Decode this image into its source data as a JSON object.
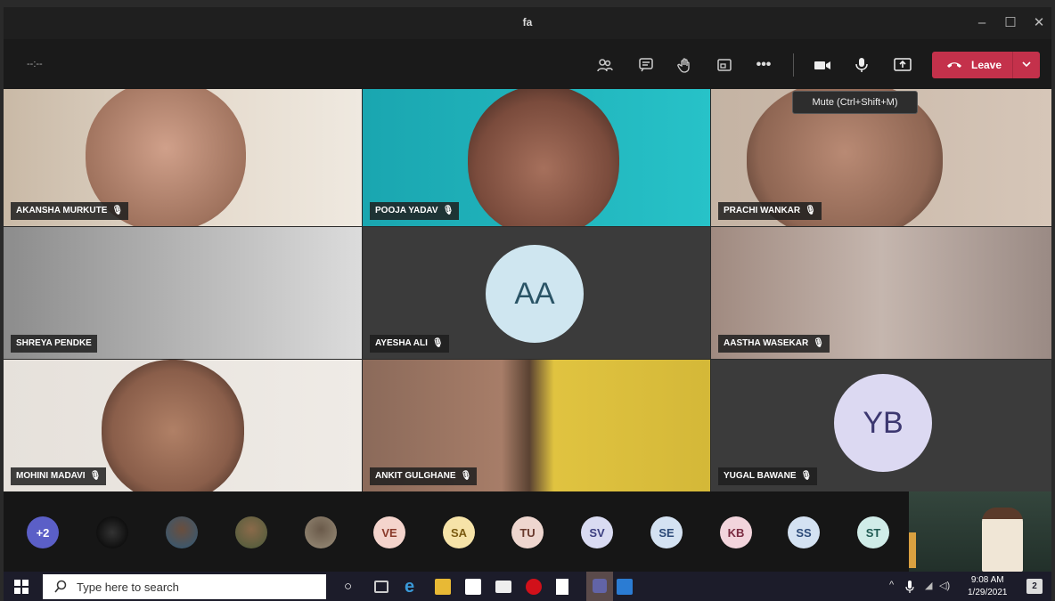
{
  "window": {
    "title": "fa"
  },
  "toolbar": {
    "timer": "--:--",
    "leave_label": "Leave",
    "tooltip": "Mute (Ctrl+Shift+M)",
    "icons": [
      "participants-icon",
      "chat-icon",
      "raise-hand-icon",
      "rooms-icon",
      "more-icon",
      "camera-icon",
      "mic-icon",
      "share-icon"
    ]
  },
  "tiles": [
    {
      "name": "AKANSHA MURKUTE"
    },
    {
      "name": "POOJA YADAV"
    },
    {
      "name": "PRACHI WANKAR"
    },
    {
      "name": "SHREYA PENDKE"
    },
    {
      "name": "AYESHA ALI",
      "initials": "AA"
    },
    {
      "name": "AASTHA WASEKAR"
    },
    {
      "name": "MOHINI MADAVI"
    },
    {
      "name": "ANKIT GULGHANE"
    },
    {
      "name": "YUGAL BAWANE",
      "initials": "YB"
    }
  ],
  "strip": {
    "overflow": "+2",
    "chips": [
      "VE",
      "SA",
      "TU",
      "SV",
      "SE",
      "KB",
      "SS",
      "ST"
    ]
  },
  "taskbar": {
    "search_placeholder": "Type here to search",
    "time": "9:08 AM",
    "date": "1/29/2021",
    "notifications": "2"
  }
}
